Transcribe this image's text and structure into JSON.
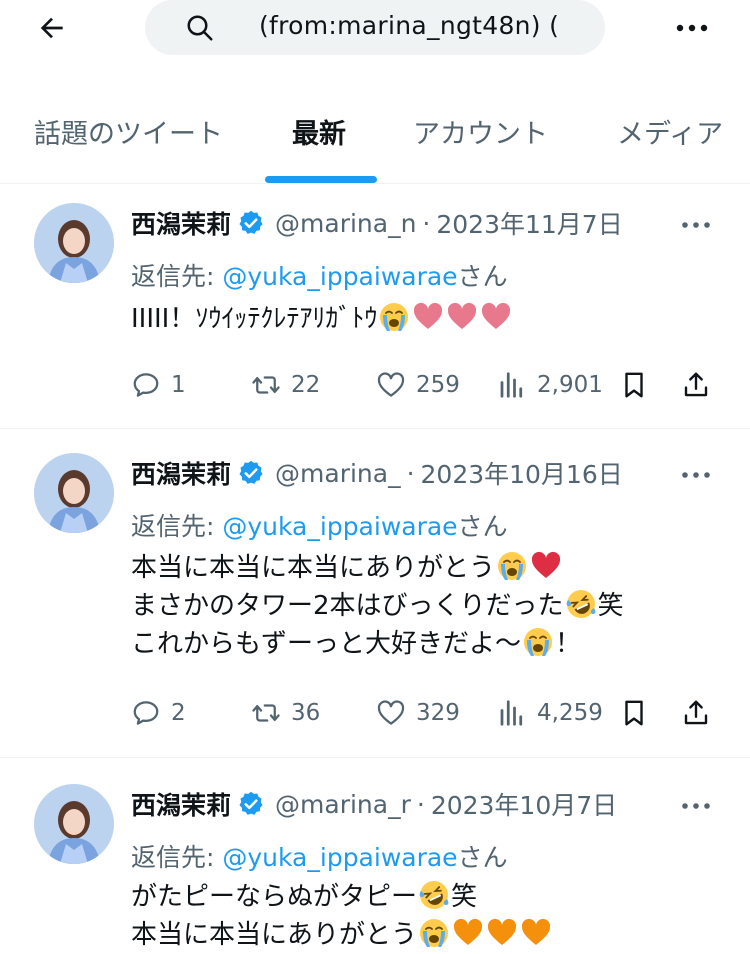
{
  "search": {
    "query": "(from:marina_ngt48n) ("
  },
  "tabs": [
    {
      "label": "話題のツイート"
    },
    {
      "label": "最新"
    },
    {
      "label": "アカウント"
    },
    {
      "label": "メディア"
    }
  ],
  "colors": {
    "accent": "#1d9bf0",
    "muted": "#536471",
    "text": "#0f1419"
  },
  "tweets": [
    {
      "name": "西潟茉莉",
      "handle": "@marina_n",
      "date": "2023年11月7日",
      "reply_prefix": "返信先: ",
      "reply_user": "@yuka_ippaiwarae",
      "reply_suffix": "さん",
      "lines": [
        "IIIII！ｿｳｲｯﾃｸﾚﾃｱﾘｶﾞﾄｳ"
      ],
      "line_emojis": [
        [
          "crying-face",
          "pink-heart",
          "pink-heart",
          "pink-heart"
        ]
      ],
      "replies": "1",
      "retweets": "22",
      "likes": "259",
      "views": "2,901"
    },
    {
      "name": "西潟茉莉",
      "handle": "@marina_",
      "date": "2023年10月16日",
      "reply_prefix": "返信先: ",
      "reply_user": "@yuka_ippaiwarae",
      "reply_suffix": "さん",
      "lines": [
        "本当に本当に本当にありがとう",
        "まさかのタワー2本はびっくりだった",
        "これからもずーっと大好きだよ〜"
      ],
      "line_tails": [
        "",
        "笑",
        "！"
      ],
      "line_emojis": [
        [
          "crying-face",
          "red-heart"
        ],
        [
          "rolling-laughing-face"
        ],
        [
          "crying-face"
        ]
      ],
      "replies": "2",
      "retweets": "36",
      "likes": "329",
      "views": "4,259"
    },
    {
      "name": "西潟茉莉",
      "handle": "@marina_r",
      "date": "2023年10月7日",
      "reply_prefix": "返信先: ",
      "reply_user": "@yuka_ippaiwarae",
      "reply_suffix": "さん",
      "lines": [
        "がたピーならぬがタピー",
        "本当に本当にありがとう"
      ],
      "line_tails": [
        "笑",
        ""
      ],
      "line_emojis": [
        [
          "rolling-laughing-face"
        ],
        [
          "crying-face",
          "orange-heart",
          "orange-heart",
          "orange-heart"
        ]
      ]
    }
  ]
}
